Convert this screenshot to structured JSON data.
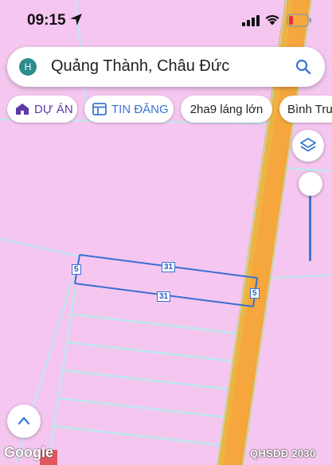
{
  "status": {
    "time": "09:15"
  },
  "search": {
    "avatar_letter": "H",
    "query": "Quảng Thành, Châu Đức"
  },
  "chips": [
    {
      "label": "DỰ ÁN",
      "icon": "house-icon"
    },
    {
      "label": "TIN ĐĂNG",
      "icon": "listing-icon"
    },
    {
      "label": "2ha9 láng lớn"
    },
    {
      "label": "Bình Tru"
    }
  ],
  "map": {
    "parcel_labels": [
      "31",
      "31",
      "5",
      "5"
    ],
    "logo": "Google",
    "caption": "QHSDĐ 2030"
  },
  "colors": {
    "land_use": "#f5c6f0",
    "road": "#f5a63c",
    "parcel_border": "#3a6fd0",
    "accent": "#3a76d4"
  }
}
